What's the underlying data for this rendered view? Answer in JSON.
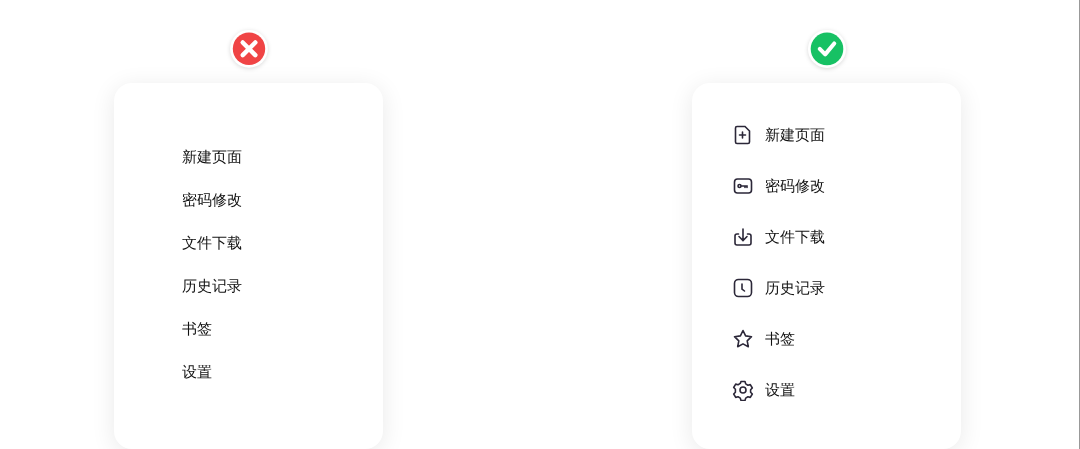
{
  "panels": [
    {
      "kind": "bad",
      "items": [
        "新建页面",
        "密码修改",
        "文件下载",
        "历史记录",
        "书签",
        "设置"
      ]
    },
    {
      "kind": "good",
      "items": [
        "新建页面",
        "密码修改",
        "文件下载",
        "历史记录",
        "书签",
        "设置"
      ]
    }
  ]
}
